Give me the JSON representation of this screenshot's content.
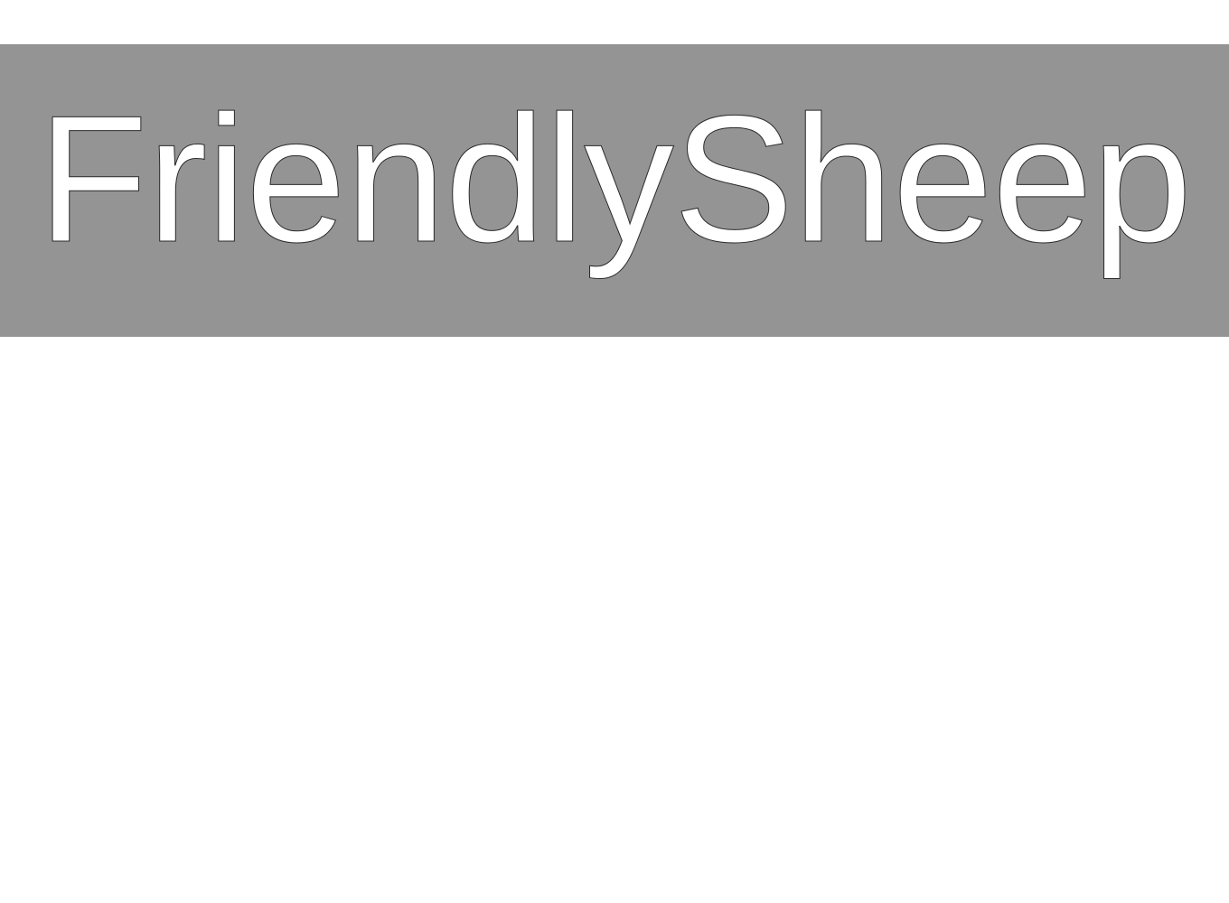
{
  "banner": {
    "title": "FriendlySheep",
    "background_color": "#949494",
    "text_color": "#ffffff",
    "outline_color": "#2a2a2a"
  }
}
